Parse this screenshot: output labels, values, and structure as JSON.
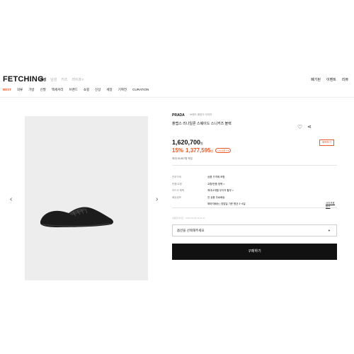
{
  "header": {
    "logo": "FETCHING",
    "gender_tabs": [
      "여성",
      "남성",
      "키즈",
      "라이프"
    ],
    "active_gender": "여성",
    "more_icon": "chevron-down-icon",
    "util_links": [
      "폐기된",
      "이벤트",
      "리뷰"
    ]
  },
  "categories": [
    "BEST",
    "의류",
    "가방",
    "신발",
    "액세서리",
    "브랜드",
    "쇼핑",
    "신상",
    "세일",
    "기획전",
    "CURATION"
  ],
  "gallery": {
    "prev_icon": "chevron-left-icon",
    "next_icon": "chevron-right-icon"
  },
  "product": {
    "brand": "PRADA",
    "brand_sub": "· 브랜드 매장가 이미지",
    "title": "플랩스 리나일론 스웨이드 스니커즈 블랙",
    "price": "1,620,700",
    "price_unit": "원",
    "discount_pct": "15%",
    "sale_price": "1,377,595",
    "sale_unit": "원",
    "coupon_label": "나의쿠폰가 ▾",
    "benefit_label": "혜택보기",
    "points": "최대 28,887원 적립"
  },
  "details": [
    {
      "label": "관부가세",
      "value": "상품 가격에 포함"
    },
    {
      "label": "반품/교환",
      "value": "교환/반품 정책 >"
    },
    {
      "label": "카드사 혜택",
      "value": "최대 6개월 무이자 할부 >"
    },
    {
      "label": "배송정보",
      "value": "전 상품 무료배송"
    },
    {
      "label": "",
      "value": "해외직배송 | 영업일 기준 평균 3~4일"
    }
  ],
  "size_guide": "사이즈표 보기",
  "date_line": "상품업데이트 · 2020.09.04 19:41:41",
  "option_select": {
    "value": "옵션을 선택해주세요",
    "caret": "▾"
  },
  "buy_button": "구매하기"
}
